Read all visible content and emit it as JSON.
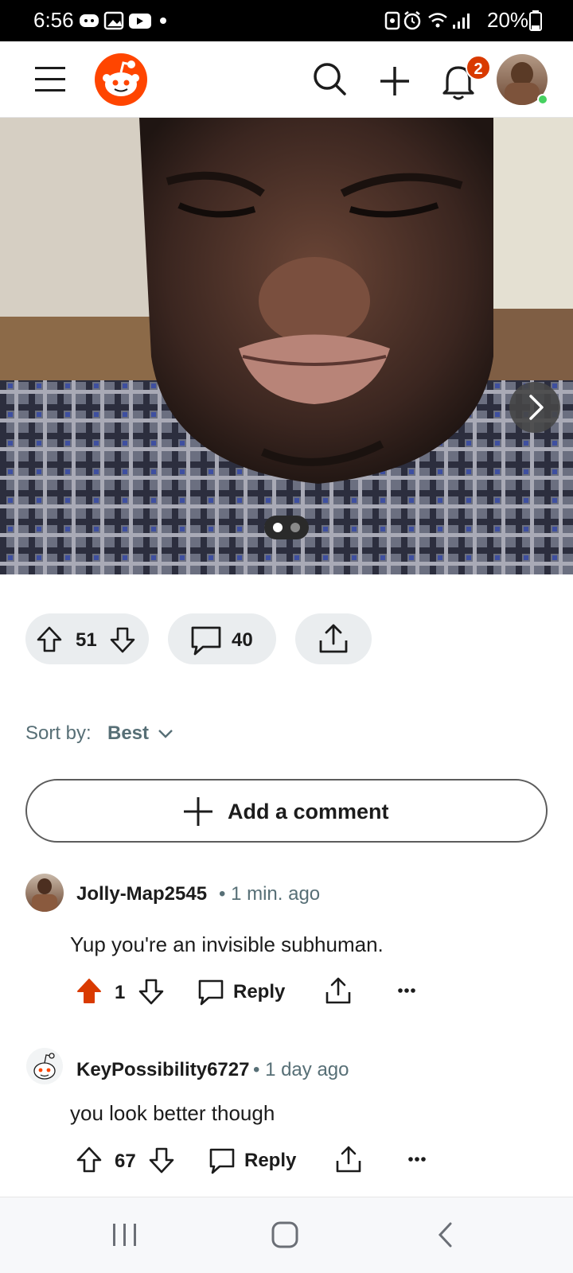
{
  "status_bar": {
    "time": "6:56",
    "battery": "20%"
  },
  "header": {
    "notification_count": "2",
    "icons": [
      "menu-icon",
      "reddit-logo",
      "search-icon",
      "create-icon",
      "bell-icon",
      "user-avatar"
    ]
  },
  "post": {
    "carousel": {
      "current": 1,
      "total": 2
    },
    "upvotes": "51",
    "comments": "40"
  },
  "sort": {
    "label": "Sort by:",
    "value": "Best"
  },
  "add_comment": {
    "label": "Add a comment"
  },
  "comments": [
    {
      "author": "Jolly-Map2545",
      "time": "• 1 min. ago",
      "text": "Yup you're an invisible subhuman.",
      "score": "1",
      "upvoted": true,
      "reply_label": "Reply"
    },
    {
      "author": "KeyPossibility6727",
      "time": "• 1 day ago",
      "text": "you look better though",
      "score": "67",
      "upvoted": false,
      "reply_label": "Reply"
    }
  ],
  "colors": {
    "accent": "#d93a00",
    "brand": "#ff4500",
    "muted_text": "#576f76",
    "pill_bg": "#eaedef"
  }
}
